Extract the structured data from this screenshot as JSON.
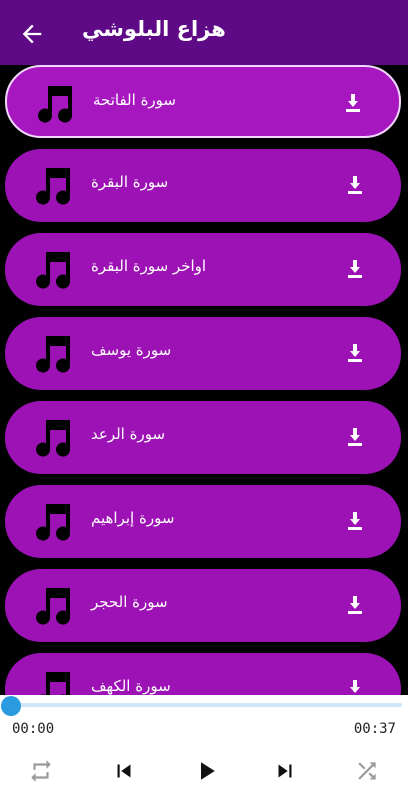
{
  "app": {
    "title": "هزاع البلوشي"
  },
  "tracks": [
    {
      "label": "سورة الفاتحة"
    },
    {
      "label": "سورة البقرة"
    },
    {
      "label": "اواخر سورة البقرة"
    },
    {
      "label": "سورة يوسف"
    },
    {
      "label": "سورة الرعد"
    },
    {
      "label": "سورة إبراهيم"
    },
    {
      "label": "سورة الحجر"
    },
    {
      "label": "سورة الكهف"
    }
  ],
  "player": {
    "current_time": "00:00",
    "total_time": "00:37",
    "progress": 0
  },
  "colors": {
    "appbar": "#5e0a86",
    "item": "#9d12b5",
    "accent": "#2b9be0"
  }
}
